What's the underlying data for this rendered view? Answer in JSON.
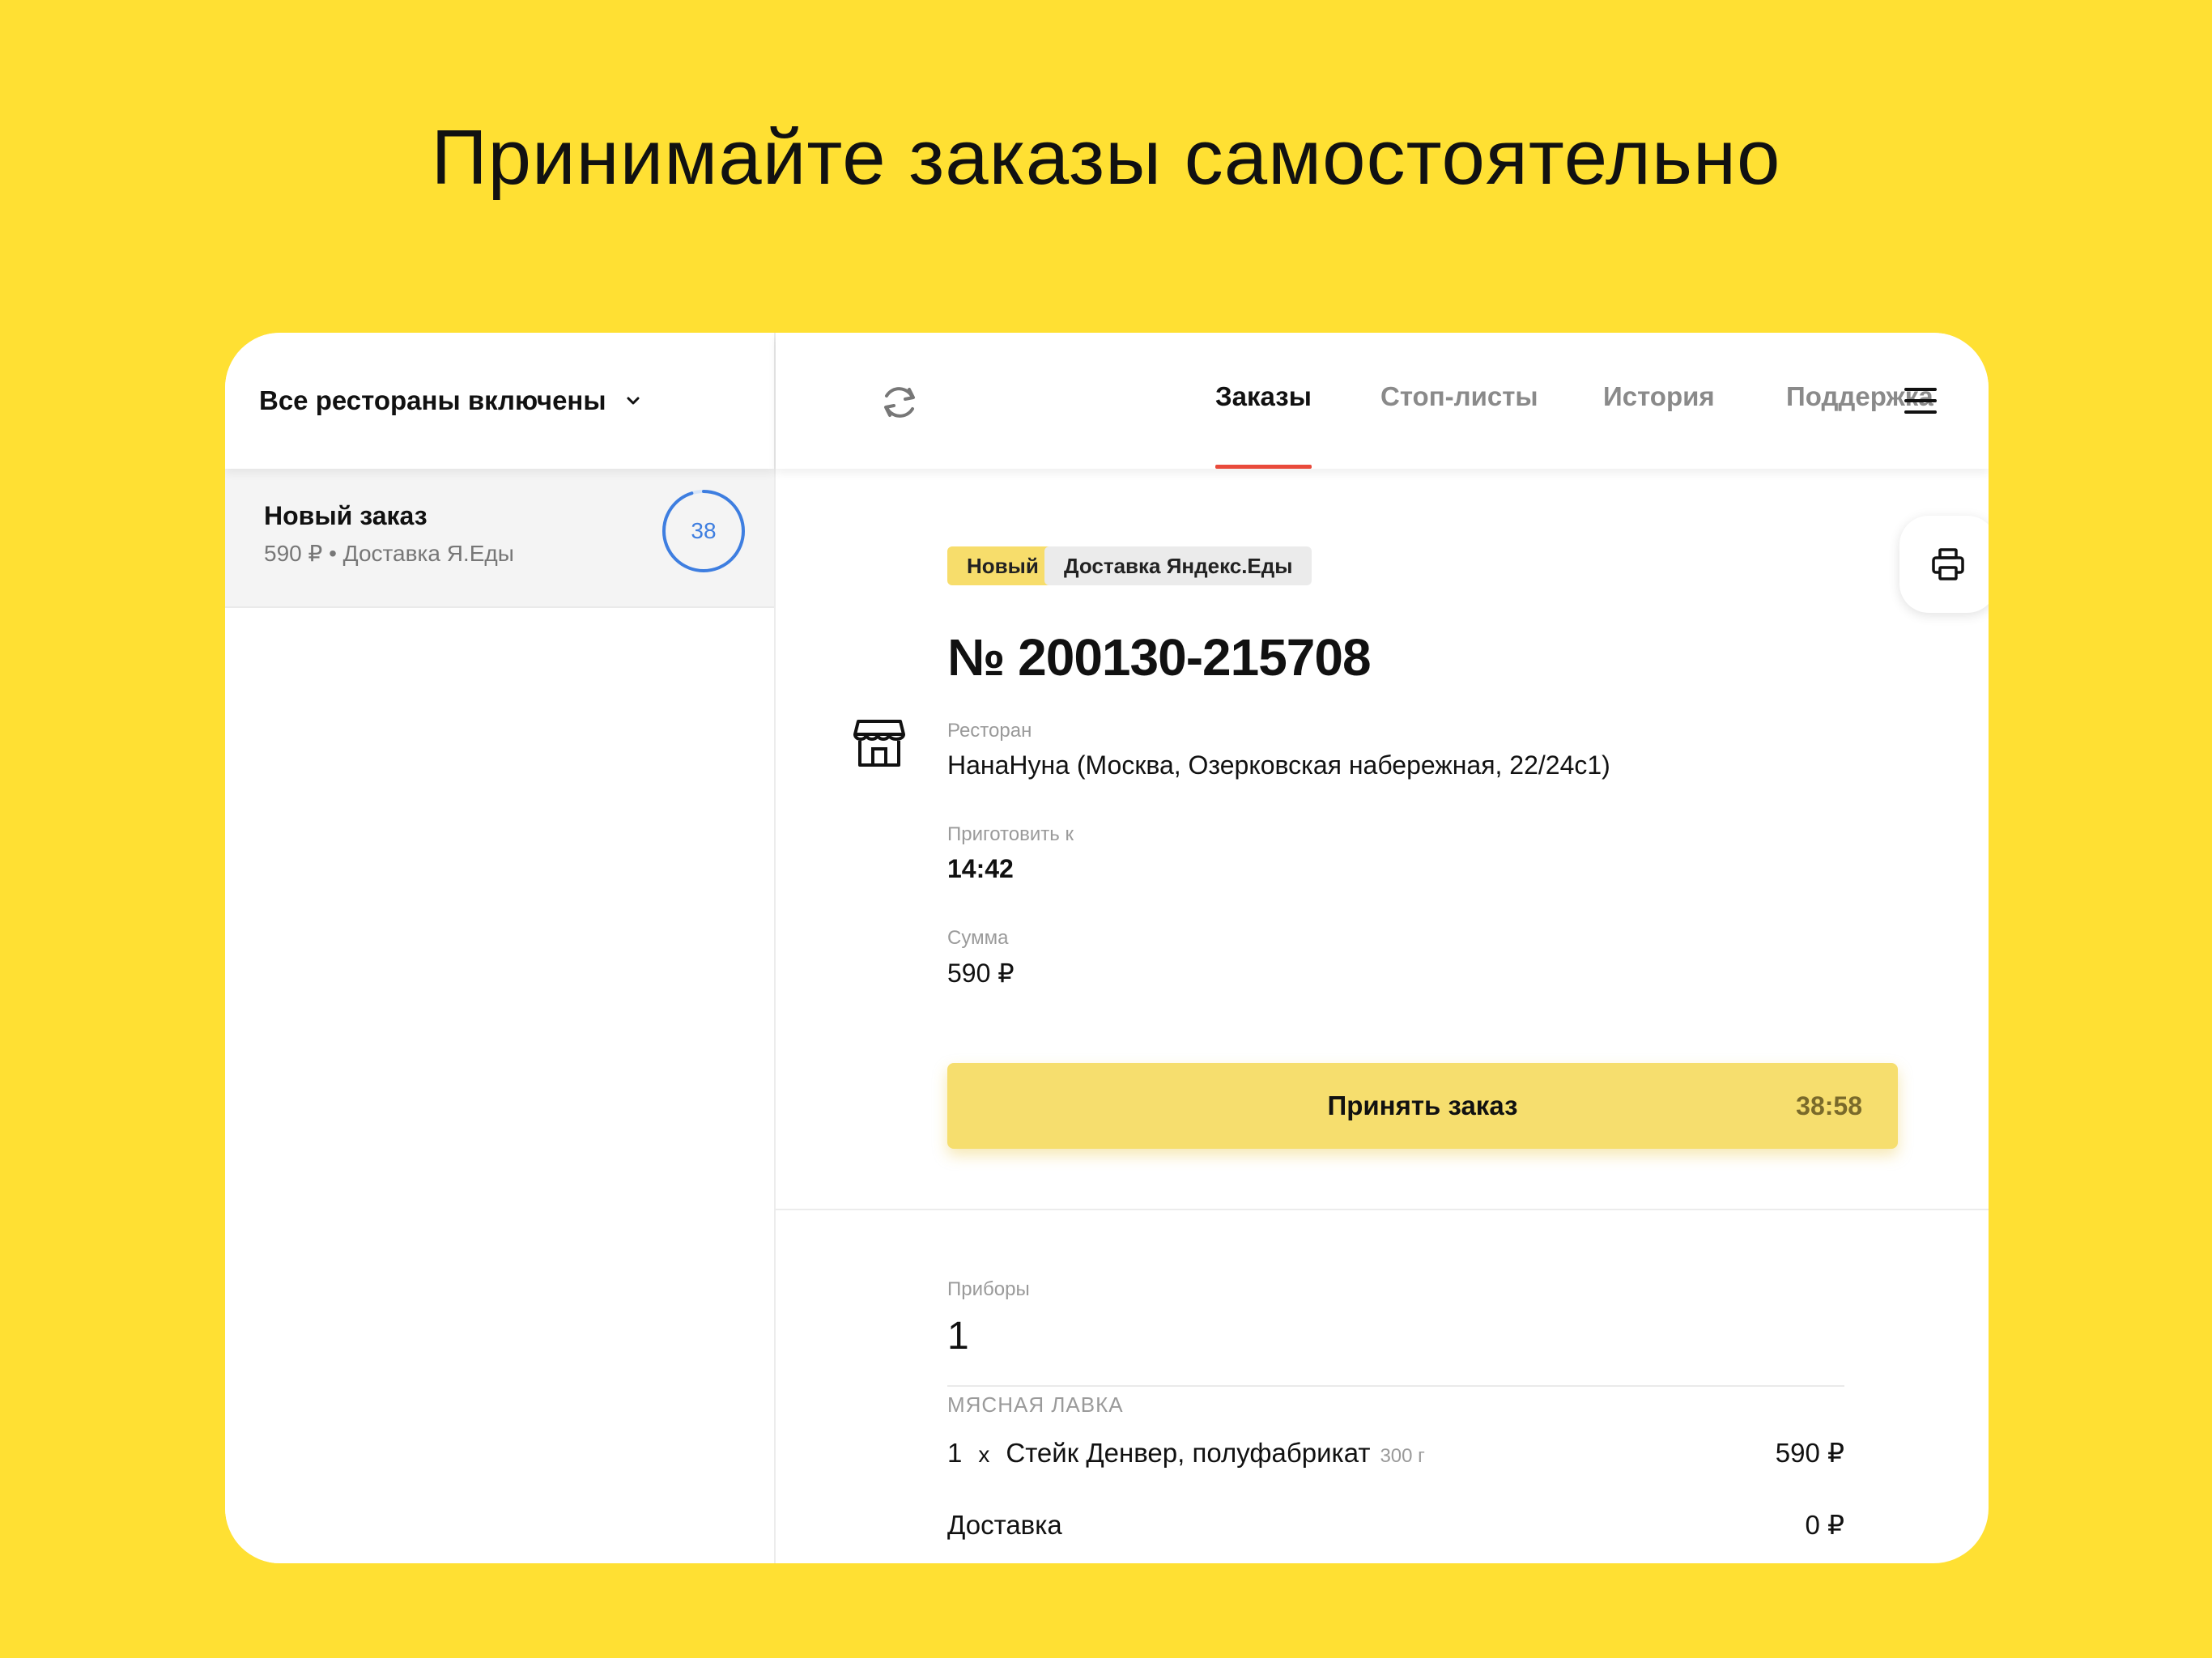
{
  "headline": "Принимайте заказы самостоятельно",
  "sidebar": {
    "restaurants_toggle": "Все рестораны включены",
    "orders": [
      {
        "title": "Новый заказ",
        "subtitle": "590 ₽ • Доставка Я.Еды",
        "timer": "38",
        "timer_fraction": 0.95
      }
    ]
  },
  "nav": {
    "tabs": [
      {
        "label": "Заказы",
        "active": true
      },
      {
        "label": "Стоп-листы",
        "active": false
      },
      {
        "label": "История",
        "active": false
      },
      {
        "label": "Поддержка",
        "active": false
      }
    ]
  },
  "order": {
    "status_badge": "Новый",
    "delivery_badge": "Доставка Яндекс.Еды",
    "number": "№ 200130-215708",
    "restaurant_label": "Ресторан",
    "restaurant_value": "НанаНуна (Москва, Озерковская набережная, 22/24с1)",
    "cook_by_label": "Приготовить к",
    "cook_by_value": "14:42",
    "sum_label": "Сумма",
    "sum_value": "590 ₽",
    "accept_label": "Принять заказ",
    "accept_timer": "38:58",
    "cutlery_label": "Приборы",
    "cutlery_value": "1",
    "category": "МЯСНАЯ ЛАВКА",
    "items": [
      {
        "qty": "1",
        "x": "x",
        "name": "Стейк Денвер, полуфабрикат",
        "weight": "300 г",
        "price": "590 ₽"
      }
    ],
    "delivery_label": "Доставка",
    "delivery_price": "0 ₽"
  },
  "colors": {
    "background": "#FFE033",
    "accent_tab": "#E94A3B",
    "accept_button": "#F6DE6E",
    "timer_ring": "#3E7EE0"
  }
}
